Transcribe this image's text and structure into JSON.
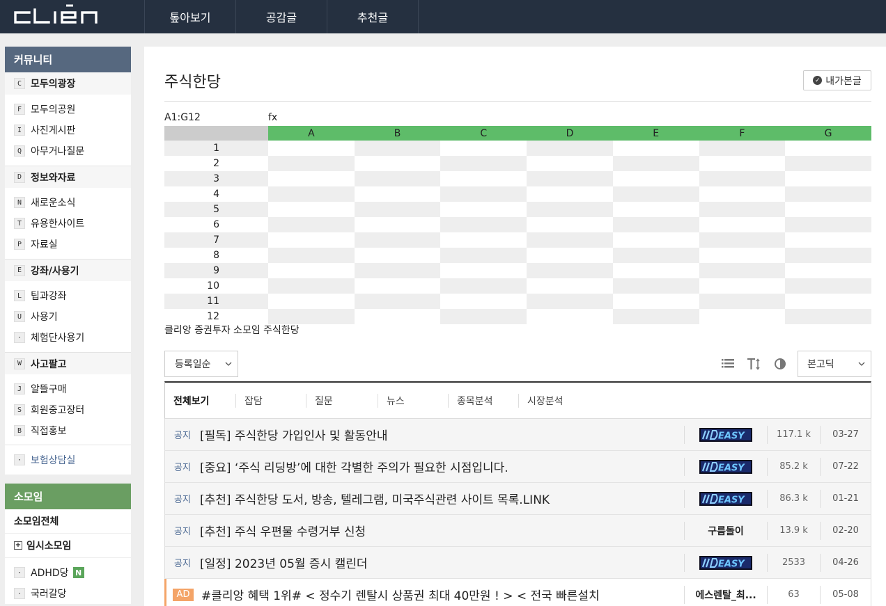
{
  "app": {
    "logo_text": "CLIĒN"
  },
  "topnav": [
    "톺아보기",
    "공감글",
    "추천글"
  ],
  "sidebar": {
    "community_title": "커뮤니티",
    "sections": [
      {
        "key": "C",
        "label": "모두의광장",
        "items": [
          {
            "key": "F",
            "label": "모두의공원"
          },
          {
            "key": "I",
            "label": "사진게시판"
          },
          {
            "key": "Q",
            "label": "아무거나질문"
          }
        ]
      },
      {
        "key": "D",
        "label": "정보와자료",
        "items": [
          {
            "key": "N",
            "label": "새로운소식"
          },
          {
            "key": "T",
            "label": "유용한사이트"
          },
          {
            "key": "P",
            "label": "자료실"
          }
        ]
      },
      {
        "key": "E",
        "label": "강좌/사용기",
        "items": [
          {
            "key": "L",
            "label": "팁과강좌"
          },
          {
            "key": "U",
            "label": "사용기"
          },
          {
            "key": "·",
            "label": "체험단사용기"
          }
        ]
      },
      {
        "key": "W",
        "label": "사고팔고",
        "items": [
          {
            "key": "J",
            "label": "알뜰구매"
          },
          {
            "key": "S",
            "label": "회원중고장터"
          },
          {
            "key": "B",
            "label": "직접홍보"
          }
        ]
      }
    ],
    "extra_item": {
      "key": "·",
      "label": "보험상담실"
    },
    "group_title": "소모임",
    "group_all": "소모임전체",
    "temp_group": "임시소모임",
    "group_items": [
      {
        "key": "·",
        "label": "ADHD당",
        "badge": "N"
      },
      {
        "key": "·",
        "label": "국러갈당"
      }
    ]
  },
  "board": {
    "title": "주식한당",
    "mine_label": "내가본글",
    "sheet": {
      "range": "A1:G12",
      "fx": "fx",
      "columns": [
        "A",
        "B",
        "C",
        "D",
        "E",
        "F",
        "G"
      ],
      "rows": [
        "1",
        "2",
        "3",
        "4",
        "5",
        "6",
        "7",
        "8",
        "9",
        "10",
        "11",
        "12"
      ]
    },
    "caption": "클리앙 증권투자 소모임 주식한당",
    "sort_label": "등록일순",
    "font_label": "본고딕",
    "tabs": [
      "전체보기",
      "잡담",
      "질문",
      "뉴스",
      "종목분석",
      "시장분석"
    ],
    "posts": [
      {
        "type": "공지",
        "title": "[필독] 주식한당 가입인사 및 활동안내",
        "author_logo": "EASY",
        "views": "117.1 k",
        "date": "03-27"
      },
      {
        "type": "공지",
        "title": "[중요] ‘주식 리딩방’에 대한 각별한 주의가 필요한 시점입니다.",
        "author_logo": "EASY",
        "views": "85.2 k",
        "date": "07-22"
      },
      {
        "type": "공지",
        "title": "[추천] 주식한당 도서, 방송, 텔레그램, 미국주식관련 사이트 목록.LINK",
        "author_logo": "EASY",
        "views": "86.3 k",
        "date": "01-21"
      },
      {
        "type": "공지",
        "title": "[추천] 주식 우편물 수령거부 신청",
        "author": "구름돌이",
        "views": "13.9 k",
        "date": "02-20"
      },
      {
        "type": "공지",
        "title": "[일정] 2023년 05월 증시 캘린더",
        "author_logo": "EASY",
        "views": "2533",
        "date": "04-26"
      }
    ],
    "ad": {
      "badge": "AD",
      "title": "#클리앙 혜택 1위# < 정수기 렌탈시 상품권 최대 40만원 ! > < 전국 빠른설치",
      "author": "에스렌탈_최...",
      "views": "63",
      "date": "05-08"
    }
  },
  "colors": {
    "topbar": "#253040",
    "community_head": "#56687f",
    "group_head": "#6a9e62",
    "sheet_header": "#5ebc69",
    "ad_accent": "#f4a468",
    "notice": "#4d6a94"
  }
}
